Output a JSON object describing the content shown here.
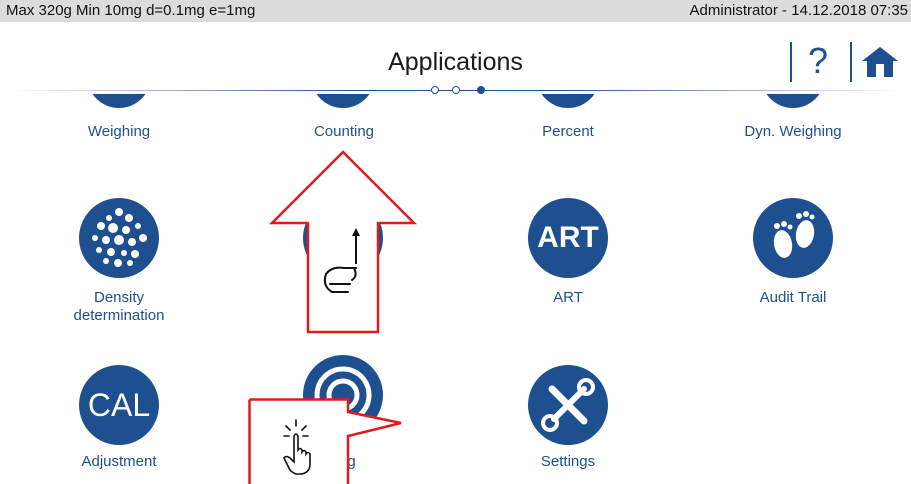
{
  "status": {
    "left": "Max 320g  Min 10mg  d=0.1mg  e=1mg",
    "right": "Administrator  -  14.12.2018 07:35"
  },
  "header": {
    "title": "Applications",
    "help": "?"
  },
  "top_row": [
    {
      "label": "Weighing"
    },
    {
      "label": "Counting"
    },
    {
      "label": "Percent"
    },
    {
      "label": "Dyn. Weighing"
    }
  ],
  "grid": {
    "density": {
      "label_line1": "Density",
      "label_line2": "determination"
    },
    "art": {
      "icon_text": "ART",
      "label": "ART"
    },
    "audit": {
      "label": "Audit Trail"
    },
    "adjustment": {
      "icon_text": "CAL",
      "label": "Adjustment"
    },
    "leveling": {
      "label": "ling"
    },
    "settings": {
      "label": "Settings"
    }
  },
  "icons": [
    "density-icon",
    "art-icon",
    "footprints-icon",
    "cal-icon",
    "target-icon",
    "tools-icon",
    "home-icon"
  ],
  "colors": {
    "accent": "#1e4f8f",
    "annotation": "#e01b1b"
  }
}
